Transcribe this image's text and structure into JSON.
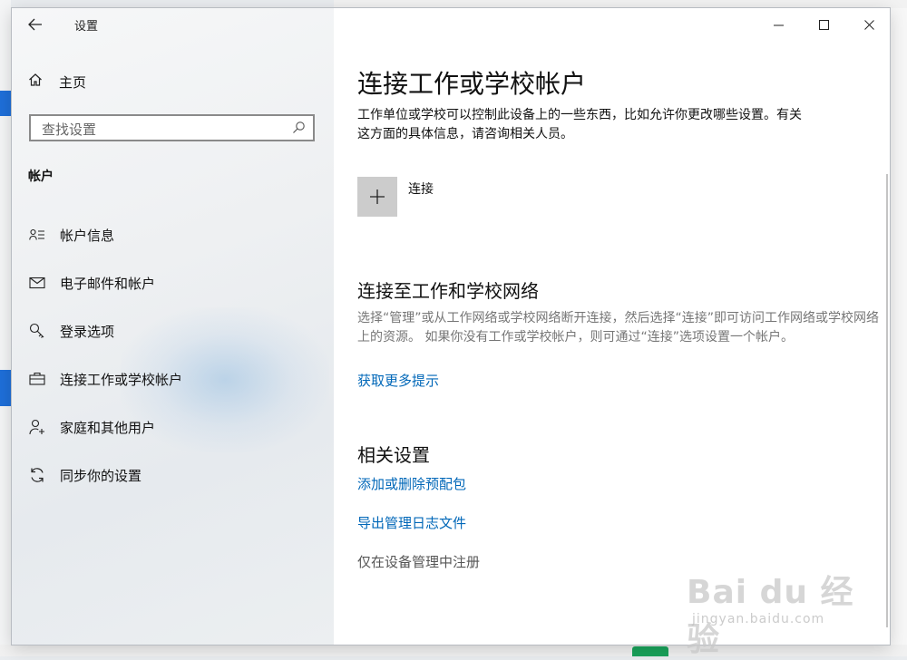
{
  "window": {
    "title": "设置"
  },
  "controls": {
    "back": "←",
    "minimize": "—",
    "maximize": "☐",
    "close": "✕"
  },
  "sidebar": {
    "home_label": "主页",
    "search_placeholder": "查找设置",
    "section_title": "帐户",
    "items": [
      {
        "label": "帐户信息",
        "icon": "account-info-icon"
      },
      {
        "label": "电子邮件和帐户",
        "icon": "email-icon"
      },
      {
        "label": "登录选项",
        "icon": "key-icon"
      },
      {
        "label": "连接工作或学校帐户",
        "icon": "briefcase-icon",
        "selected": true
      },
      {
        "label": "家庭和其他用户",
        "icon": "add-person-icon"
      },
      {
        "label": "同步你的设置",
        "icon": "sync-icon"
      }
    ]
  },
  "main": {
    "title": "连接工作或学校帐户",
    "description": "工作单位或学校可以控制此设备上的一些东西，比如允许你更改哪些设置。有关这方面的具体信息，请咨询相关人员。",
    "connect_label": "连接",
    "network_heading": "连接至工作和学校网络",
    "network_text": "选择“管理”或从工作网络或学校网络断开连接，然后选择“连接”即可访问工作网络或学校网络上的资源。 如果你没有工作或学校帐户，则可通过“连接”选项设置一个帐户。",
    "more_tips": "获取更多提示",
    "related_heading": "相关设置",
    "related_links": [
      "添加或删除预配包",
      "导出管理日志文件",
      "仅在设备管理中注册"
    ]
  },
  "watermark": {
    "brand": "Bai du 经验",
    "site": "jingyan.baidu.com"
  },
  "colors": {
    "accent": "#0067b8",
    "selected_glow": "#9fc3e6",
    "plus_tile": "#cccccc"
  }
}
